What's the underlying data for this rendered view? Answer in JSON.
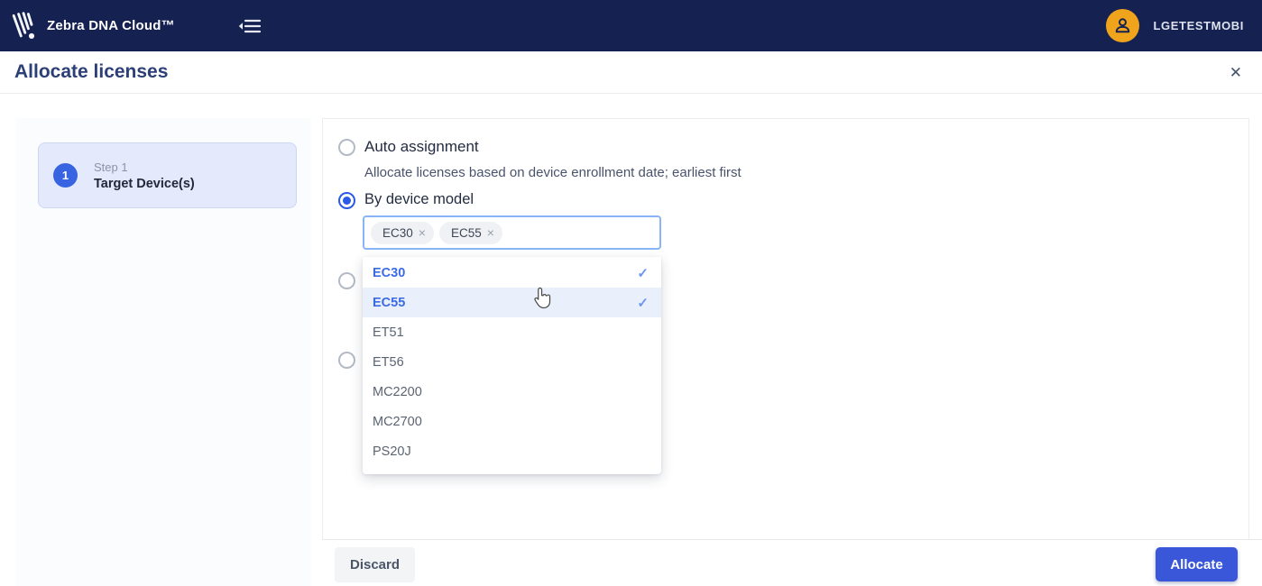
{
  "navbar": {
    "brand": "Zebra DNA Cloud™",
    "username": "LGETESTMOBI"
  },
  "icons": {
    "close": "✕",
    "chip_close": "×",
    "check": "✓"
  },
  "dialog": {
    "title": "Allocate licenses"
  },
  "step_panel": {
    "steps": [
      {
        "number": "1",
        "label": "Step 1",
        "sublabel": "Target Device(s)"
      }
    ]
  },
  "options": {
    "auto_assignment": {
      "label": "Auto assignment",
      "description": "Allocate licenses based on device enrollment date; earliest first",
      "selected": false
    },
    "by_device_model": {
      "label": "By device model",
      "selected": true
    }
  },
  "model_select": {
    "chips": [
      {
        "label": "EC30"
      },
      {
        "label": "EC55"
      }
    ],
    "dropdown_items": [
      {
        "label": "EC30",
        "selected": true,
        "highlighted": false
      },
      {
        "label": "EC55",
        "selected": true,
        "highlighted": true
      },
      {
        "label": "ET51",
        "selected": false,
        "highlighted": false
      },
      {
        "label": "ET56",
        "selected": false,
        "highlighted": false
      },
      {
        "label": "MC2200",
        "selected": false,
        "highlighted": false
      },
      {
        "label": "MC2700",
        "selected": false,
        "highlighted": false
      },
      {
        "label": "PS20J",
        "selected": false,
        "highlighted": false
      }
    ]
  },
  "footer": {
    "discard_label": "Discard",
    "allocate_label": "Allocate"
  },
  "colors": {
    "navbar_bg": "#152150",
    "accent_blue": "#3a57da",
    "avatar_orange": "#f0a41c",
    "selected_item_blue": "#3b6be2",
    "highlight_row": "#eaf0fb",
    "step_card_bg": "#e4eafb",
    "input_focus_border": "#8ab4f8"
  }
}
